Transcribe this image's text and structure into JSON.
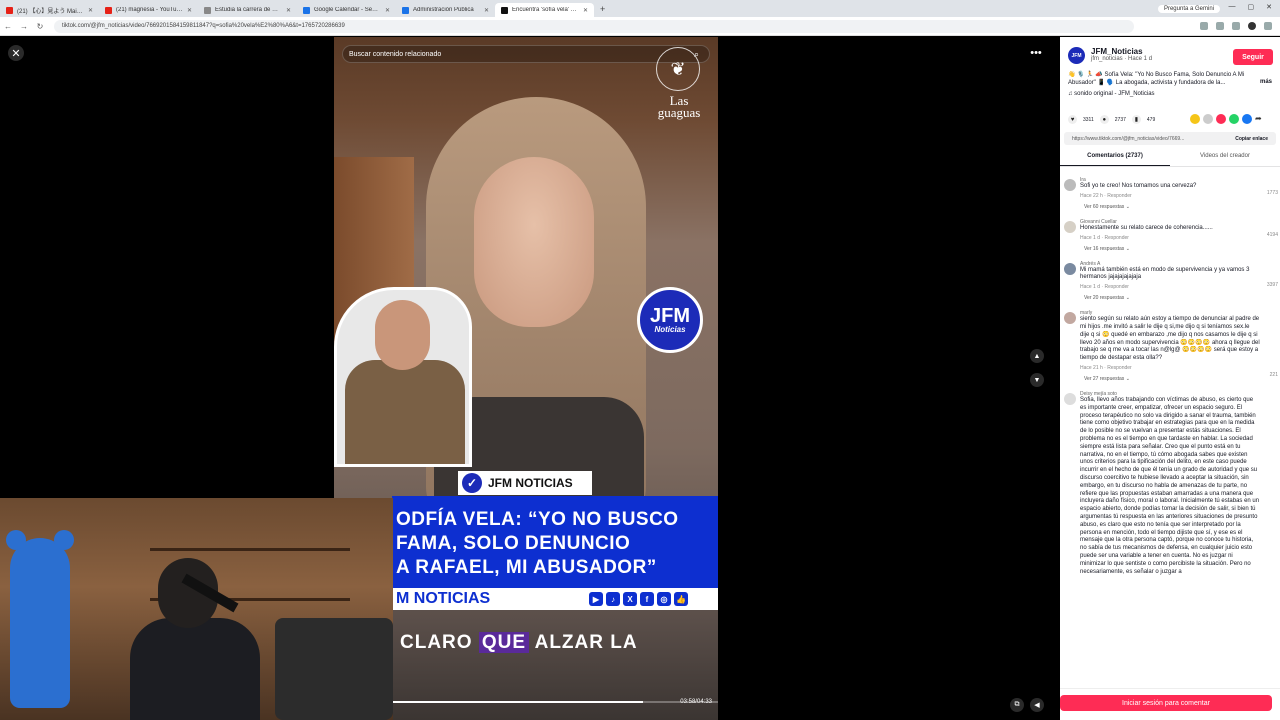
{
  "browser": {
    "tabs": [
      {
        "label": "(21) 【心】見よう Mai Matsubara",
        "color": "#e62117",
        "active": false
      },
      {
        "label": "(21) magnesia - YouTube",
        "color": "#e62117",
        "active": false
      },
      {
        "label": "Estudia la carrera de Ciencia",
        "color": "#888888",
        "active": false
      },
      {
        "label": "Google Calendar - Semana de",
        "color": "#1a73e8",
        "active": false
      },
      {
        "label": "Administración Pública",
        "color": "#1a73e8",
        "active": false
      },
      {
        "label": "Encuentra 'sofía vela' en TikTok",
        "color": "#111111",
        "active": true
      }
    ],
    "new_tab": "+",
    "gemini": "Pregunta a Gemini",
    "url": "tiktok.com/@jfm_noticias/video/7669201584159811847?q=sofia%20vela%E2%80%A6&t=1765720286639"
  },
  "video": {
    "search_placeholder": "Buscar contenido relacionado",
    "brand_line1": "Las",
    "brand_line2": "guaguas",
    "badge_line1": "JFM",
    "badge_line2": "Noticias",
    "channel_label": "JFM NOTICIAS",
    "headline_line1": "ODFÍA VELA: “YO NO BUSCO",
    "headline_line2": "FAMA, SOLO DENUNCIO",
    "headline_line3": "A RAFAEL, MI ABUSADOR”",
    "noticias_bar": "M NOTICIAS",
    "caption_pre": "CLARO",
    "caption_hl": "QUE",
    "caption_post": "ALZAR LA",
    "progress": 0.77,
    "timecode": "03:58/04:33"
  },
  "sidebar": {
    "author_name": "JFM_Noticias",
    "author_sub": "jfm_noticias · Hace 1 d",
    "avatar_text": "JFM",
    "follow": "Seguir",
    "description": "👋 🎙️ 🏃 📣 Sofía Vela: \"Yo No Busco Fama, Solo Denuncio A Mi Abusador\" 📱 🗣️ La abogada, activista y fundadora de la...",
    "more": "más",
    "sound": "♫ sonido original - JFM_Noticias",
    "likes": "3311",
    "comments_count": "2737",
    "saves": "479",
    "link": "https://www.tiktok.com/@jfm_noticias/video/7669...",
    "copy_link": "Copiar enlace",
    "tab_comments": "Comentarios (2737)",
    "tab_creator": "Videos del creador",
    "login": "Iniciar sesión para comentar"
  },
  "comments": [
    {
      "name": "Ira",
      "text": "Sofi yo te creo! Nos tomamos una cerveza?",
      "meta": "Hace 22 h · Responder",
      "likes": "1773",
      "replies": "Ver 60 respuestas ⌄"
    },
    {
      "name": "Giovanni Cuellar",
      "text": "Honestamente su relato carece de coherencia......",
      "meta": "Hace 1 d · Responder",
      "likes": "4194",
      "replies": "Ver 16 respuestas ⌄"
    },
    {
      "name": "Andrés A",
      "text": "Mi mamá también está en modo de supervivencia y ya vamos 3 hermanos jajajajajajaja",
      "meta": "Hace 1 d · Responder",
      "likes": "3397",
      "replies": "Ver 20 respuestas ⌄"
    },
    {
      "name": "marly",
      "text": "siento según su relato aún estoy a tiempo de denunciar al padre de mi hijos .me invitó a salir le dije q si,me dijo q si teníamos sex.le dije q si 😳 quedé en embarazo ,me dijo q nos casamos le dije q si llevo 20 años en modo supervivencia 😳😳😳😳 ahora q llegue del trabajo se q me va a tocar las n@lg@ 😳😳😳😳 será que estoy a tiempo de destapar esta olla??",
      "meta": "Hace 21 h · Responder",
      "likes": "221",
      "replies": "Ver 27 respuestas ⌄"
    },
    {
      "name": "Deisy mejía soto",
      "text": "Sofia, llevo años trabajando con víctimas de abuso, es cierto que es importante creer, empatizar, ofrecer un espacio seguro. El proceso terapéutico no solo va dirigido a sanar el trauma, también tiene como objetivo trabajar en estrategias para que en la medida de lo posible no se vuelvan a presentar estás situaciones. El problema no es el tiempo en que tardaste en hablar. La sociedad siempre está lista para señalar. Creo que el punto está en tu narrativa, no en el tiempo, tú cómo abogada sabes que existen unos criterios para la tipificación del delito, en este caso puede incurrir en el hecho de que él tenía un grado de autoridad y que su discurso coercitivo te hubiese llevado a aceptar la situación, sin embargo, en tu discurso no habla de amenazas de tu parte, no refiere que las propuestas estaban amarradas a una manera que incluyera daño físico, moral o laboral. Inicialmente tú estabas en un espacio abierto, donde podías tomar la decisión de salir, si bien tú argumentas tú respuesta en las anteriores situaciones de presunto abuso, es claro que esto no tenía que ser interpretado por la persona en mención, todo el tiempo dijiste que sí, y ese es el mensaje que la otra persona captó, porque no conoce tu historia, no sabía de tus mecanismos de defensa, en cualquier juicio esto puede ser una variable a tener en cuenta. No es juzgar ni minimizar lo que sentiste o como percibiste la situación. Pero no necesariamente, es señalar o juzgar a",
      "meta": "",
      "likes": "",
      "replies": ""
    }
  ]
}
